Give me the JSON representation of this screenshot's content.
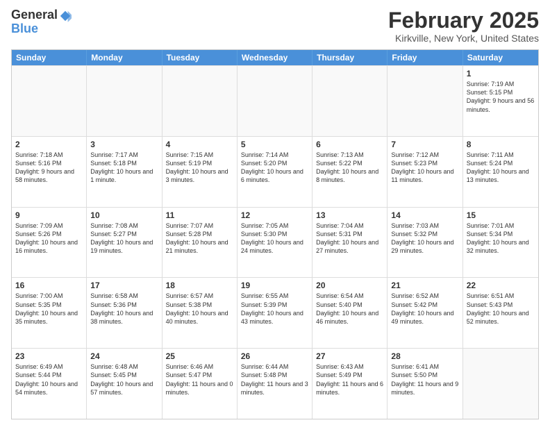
{
  "header": {
    "logo_general": "General",
    "logo_blue": "Blue",
    "month_title": "February 2025",
    "location": "Kirkville, New York, United States"
  },
  "days_of_week": [
    "Sunday",
    "Monday",
    "Tuesday",
    "Wednesday",
    "Thursday",
    "Friday",
    "Saturday"
  ],
  "weeks": [
    [
      {
        "day": "",
        "info": ""
      },
      {
        "day": "",
        "info": ""
      },
      {
        "day": "",
        "info": ""
      },
      {
        "day": "",
        "info": ""
      },
      {
        "day": "",
        "info": ""
      },
      {
        "day": "",
        "info": ""
      },
      {
        "day": "1",
        "info": "Sunrise: 7:19 AM\nSunset: 5:15 PM\nDaylight: 9 hours and 56 minutes."
      }
    ],
    [
      {
        "day": "2",
        "info": "Sunrise: 7:18 AM\nSunset: 5:16 PM\nDaylight: 9 hours and 58 minutes."
      },
      {
        "day": "3",
        "info": "Sunrise: 7:17 AM\nSunset: 5:18 PM\nDaylight: 10 hours and 1 minute."
      },
      {
        "day": "4",
        "info": "Sunrise: 7:15 AM\nSunset: 5:19 PM\nDaylight: 10 hours and 3 minutes."
      },
      {
        "day": "5",
        "info": "Sunrise: 7:14 AM\nSunset: 5:20 PM\nDaylight: 10 hours and 6 minutes."
      },
      {
        "day": "6",
        "info": "Sunrise: 7:13 AM\nSunset: 5:22 PM\nDaylight: 10 hours and 8 minutes."
      },
      {
        "day": "7",
        "info": "Sunrise: 7:12 AM\nSunset: 5:23 PM\nDaylight: 10 hours and 11 minutes."
      },
      {
        "day": "8",
        "info": "Sunrise: 7:11 AM\nSunset: 5:24 PM\nDaylight: 10 hours and 13 minutes."
      }
    ],
    [
      {
        "day": "9",
        "info": "Sunrise: 7:09 AM\nSunset: 5:26 PM\nDaylight: 10 hours and 16 minutes."
      },
      {
        "day": "10",
        "info": "Sunrise: 7:08 AM\nSunset: 5:27 PM\nDaylight: 10 hours and 19 minutes."
      },
      {
        "day": "11",
        "info": "Sunrise: 7:07 AM\nSunset: 5:28 PM\nDaylight: 10 hours and 21 minutes."
      },
      {
        "day": "12",
        "info": "Sunrise: 7:05 AM\nSunset: 5:30 PM\nDaylight: 10 hours and 24 minutes."
      },
      {
        "day": "13",
        "info": "Sunrise: 7:04 AM\nSunset: 5:31 PM\nDaylight: 10 hours and 27 minutes."
      },
      {
        "day": "14",
        "info": "Sunrise: 7:03 AM\nSunset: 5:32 PM\nDaylight: 10 hours and 29 minutes."
      },
      {
        "day": "15",
        "info": "Sunrise: 7:01 AM\nSunset: 5:34 PM\nDaylight: 10 hours and 32 minutes."
      }
    ],
    [
      {
        "day": "16",
        "info": "Sunrise: 7:00 AM\nSunset: 5:35 PM\nDaylight: 10 hours and 35 minutes."
      },
      {
        "day": "17",
        "info": "Sunrise: 6:58 AM\nSunset: 5:36 PM\nDaylight: 10 hours and 38 minutes."
      },
      {
        "day": "18",
        "info": "Sunrise: 6:57 AM\nSunset: 5:38 PM\nDaylight: 10 hours and 40 minutes."
      },
      {
        "day": "19",
        "info": "Sunrise: 6:55 AM\nSunset: 5:39 PM\nDaylight: 10 hours and 43 minutes."
      },
      {
        "day": "20",
        "info": "Sunrise: 6:54 AM\nSunset: 5:40 PM\nDaylight: 10 hours and 46 minutes."
      },
      {
        "day": "21",
        "info": "Sunrise: 6:52 AM\nSunset: 5:42 PM\nDaylight: 10 hours and 49 minutes."
      },
      {
        "day": "22",
        "info": "Sunrise: 6:51 AM\nSunset: 5:43 PM\nDaylight: 10 hours and 52 minutes."
      }
    ],
    [
      {
        "day": "23",
        "info": "Sunrise: 6:49 AM\nSunset: 5:44 PM\nDaylight: 10 hours and 54 minutes."
      },
      {
        "day": "24",
        "info": "Sunrise: 6:48 AM\nSunset: 5:45 PM\nDaylight: 10 hours and 57 minutes."
      },
      {
        "day": "25",
        "info": "Sunrise: 6:46 AM\nSunset: 5:47 PM\nDaylight: 11 hours and 0 minutes."
      },
      {
        "day": "26",
        "info": "Sunrise: 6:44 AM\nSunset: 5:48 PM\nDaylight: 11 hours and 3 minutes."
      },
      {
        "day": "27",
        "info": "Sunrise: 6:43 AM\nSunset: 5:49 PM\nDaylight: 11 hours and 6 minutes."
      },
      {
        "day": "28",
        "info": "Sunrise: 6:41 AM\nSunset: 5:50 PM\nDaylight: 11 hours and 9 minutes."
      },
      {
        "day": "",
        "info": ""
      }
    ]
  ]
}
